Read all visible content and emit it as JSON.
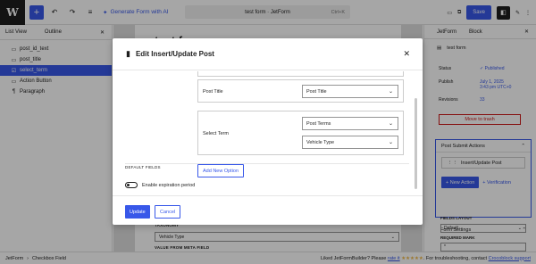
{
  "toolbar": {
    "logo": "W",
    "add_icon": "+",
    "undo_icon": "↶",
    "redo_icon": "↷",
    "outline_icon": "≡",
    "ai_icon": "✦",
    "generate_label": "Generate Form with AI",
    "doc_title": "test form · JetForm",
    "shortcut": "Ctrl+K",
    "view_icon": "▭",
    "preview_icon": "⧉",
    "settings_icon": "◧",
    "brush_icon": "✎",
    "save_label": "Save",
    "more_icon": "⋮"
  },
  "list_view": {
    "tabs": [
      "List View",
      "Outline"
    ],
    "close": "✕",
    "items": [
      {
        "icon": "▭",
        "label": "post_id_text"
      },
      {
        "icon": "▭",
        "label": "post_title"
      },
      {
        "icon": "☑",
        "label": "select_term",
        "selected": true
      },
      {
        "icon": "▭",
        "label": "Action Button"
      },
      {
        "icon": "¶",
        "label": "Paragraph"
      }
    ]
  },
  "canvas": {
    "title": "test form",
    "taxonomy_label": "TAXONOMY",
    "taxonomy_value": "Vehicle Type",
    "meta_label": "VALUE FROM META FIELD"
  },
  "sidebar": {
    "tabs": [
      "JetForm",
      "Block"
    ],
    "close": "✕",
    "doc_icon": "▤",
    "doc_name": "test form",
    "status_label": "Status",
    "status_value": "Published",
    "publish_label": "Publish",
    "publish_value_1": "July 1, 2025",
    "publish_value_2": "3:43 pm UTC+0",
    "revisions_label": "Revisions",
    "revisions_value": "33",
    "trash_label": "Move to trash",
    "psa_title": "Post Submit Actions",
    "action_item": "Insert/Update Post",
    "new_action": "+ New Action",
    "verification": "+ Verification",
    "form_settings": "Form Settings",
    "fields_layout_label": "FIELDS LAYOUT",
    "fields_layout_value": "Default",
    "required_mark_label": "REQUIRED MARK",
    "required_mark_value": "*"
  },
  "footer": {
    "breadcrumb": [
      "JetForm",
      "Checkbox Field"
    ],
    "separator": "›",
    "rate_prefix": "Liked JetFormBuilder? Please",
    "rate_link": "rate it",
    "stars": "★★★★★",
    "trouble_prefix": ". For troubleshooting, contact",
    "support_link": "Crocoblock support"
  },
  "modal": {
    "title_icon": "▮",
    "title": "Edit Insert/Update Post",
    "close": "✕",
    "post_title_label": "Post Title",
    "post_title_value": "Post Title",
    "select_term_label": "Select Term",
    "post_terms_value": "Post Terms",
    "vehicle_type_value": "Vehicle Type",
    "default_fields": "DEFAULT FIELDS",
    "add_new_option": "Add New Option",
    "expiration_label": "Enable expiration period",
    "update_label": "Update",
    "cancel_label": "Cancel"
  }
}
